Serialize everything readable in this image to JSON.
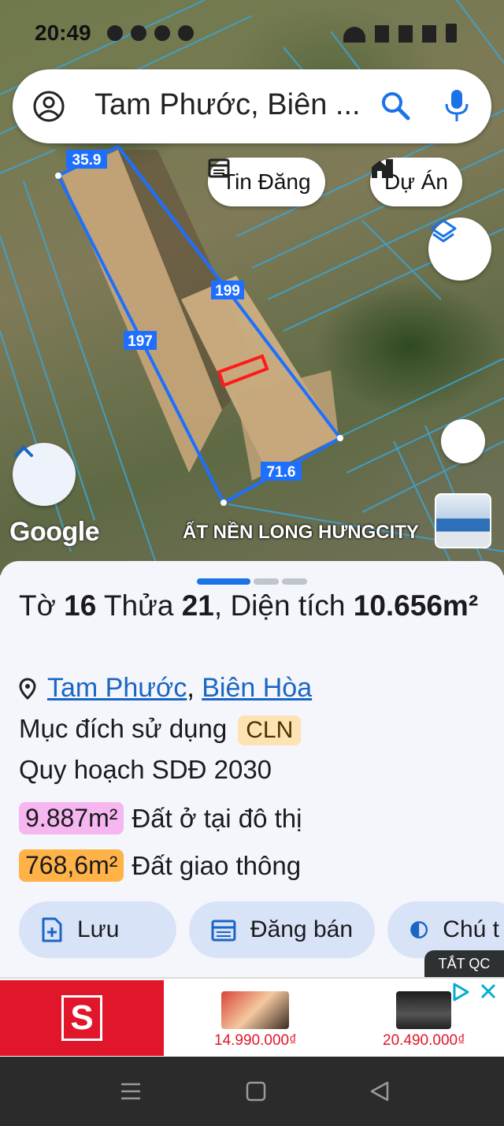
{
  "status_bar": {
    "time": "20:49"
  },
  "search": {
    "text": "Tam Phước, Biên ..."
  },
  "chips": {
    "listings": "Tin Đăng",
    "projects": "Dự Án"
  },
  "map": {
    "edge_labels": [
      "35.9",
      "199",
      "197",
      "71.6"
    ],
    "attribution": "Google",
    "ad_label": "ẤT NỀN LONG HƯNGCITY"
  },
  "parcel": {
    "title_sheet_prefix": "Tờ ",
    "sheet_no": "16",
    "title_lot_prefix": " Thửa ",
    "lot_no": "21",
    "title_area_prefix": ", Diện tích ",
    "area": "10.656m²",
    "location_ward": "Tam Phước",
    "location_sep": ",",
    "location_city": "Biên Hòa",
    "purpose_label": "Mục đích sử dụng",
    "purpose_code": "CLN",
    "plan_label": "Quy hoạch SDĐ 2030",
    "zones": [
      {
        "area": "9.887m²",
        "label": "Đất ở tại đô thị",
        "color": "#f6b6ef"
      },
      {
        "area": "768,6m²",
        "label": "Đất giao thông",
        "color": "#ffb347"
      }
    ]
  },
  "actions": {
    "save": "Lưu",
    "sell": "Đăng bán",
    "note": "Chú t"
  },
  "ads": {
    "hide_label": "TẮT QC",
    "logo_letter": "S",
    "products": [
      {
        "price": "14.990.000₫"
      },
      {
        "price": "20.490.000₫"
      }
    ]
  },
  "colors": {
    "accent": "#1a73e8",
    "parcel_outline": "#1f6fff",
    "highlight": "#ff1a1a",
    "chip_bg": "#d9e3f7"
  }
}
